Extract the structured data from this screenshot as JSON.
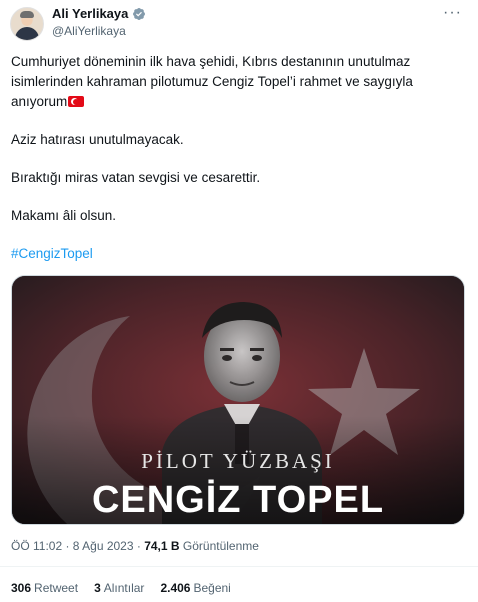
{
  "author": {
    "name": "Ali Yerlikaya",
    "handle": "@AliYerlikaya"
  },
  "tweet": {
    "paragraph1": "Cumhuriyet döneminin ilk hava şehidi, Kıbrıs destanının unutulmaz isimlerinden kahraman pilotumuz Cengiz Topel’i rahmet ve saygıyla anıyorum",
    "paragraph2": "Aziz hatırası unutulmayacak.",
    "paragraph3": "Bıraktığı miras vatan sevgisi ve cesarettir.",
    "paragraph4": "Makamı âli olsun.",
    "hashtag": "#CengizTopel"
  },
  "media": {
    "subtitle": "PİLOT YÜZBAŞI",
    "title": "CENGİZ TOPEL"
  },
  "meta": {
    "time": "ÖÖ 11:02 · 8 Ağu 2023 · ",
    "views": "74,1 B",
    "views_label": "Görüntülenme"
  },
  "stats": {
    "retweets": "306",
    "retweets_label": "Retweet",
    "quotes": "3",
    "quotes_label": "Alıntılar",
    "likes": "2.406",
    "likes_label": "Beğeni"
  },
  "colors": {
    "link": "#1d9bf0",
    "verified": "#829aab",
    "flag_red": "#e30a17"
  },
  "icons": [
    "verified-badge-icon",
    "more-options-icon",
    "turkey-flag-icon"
  ]
}
